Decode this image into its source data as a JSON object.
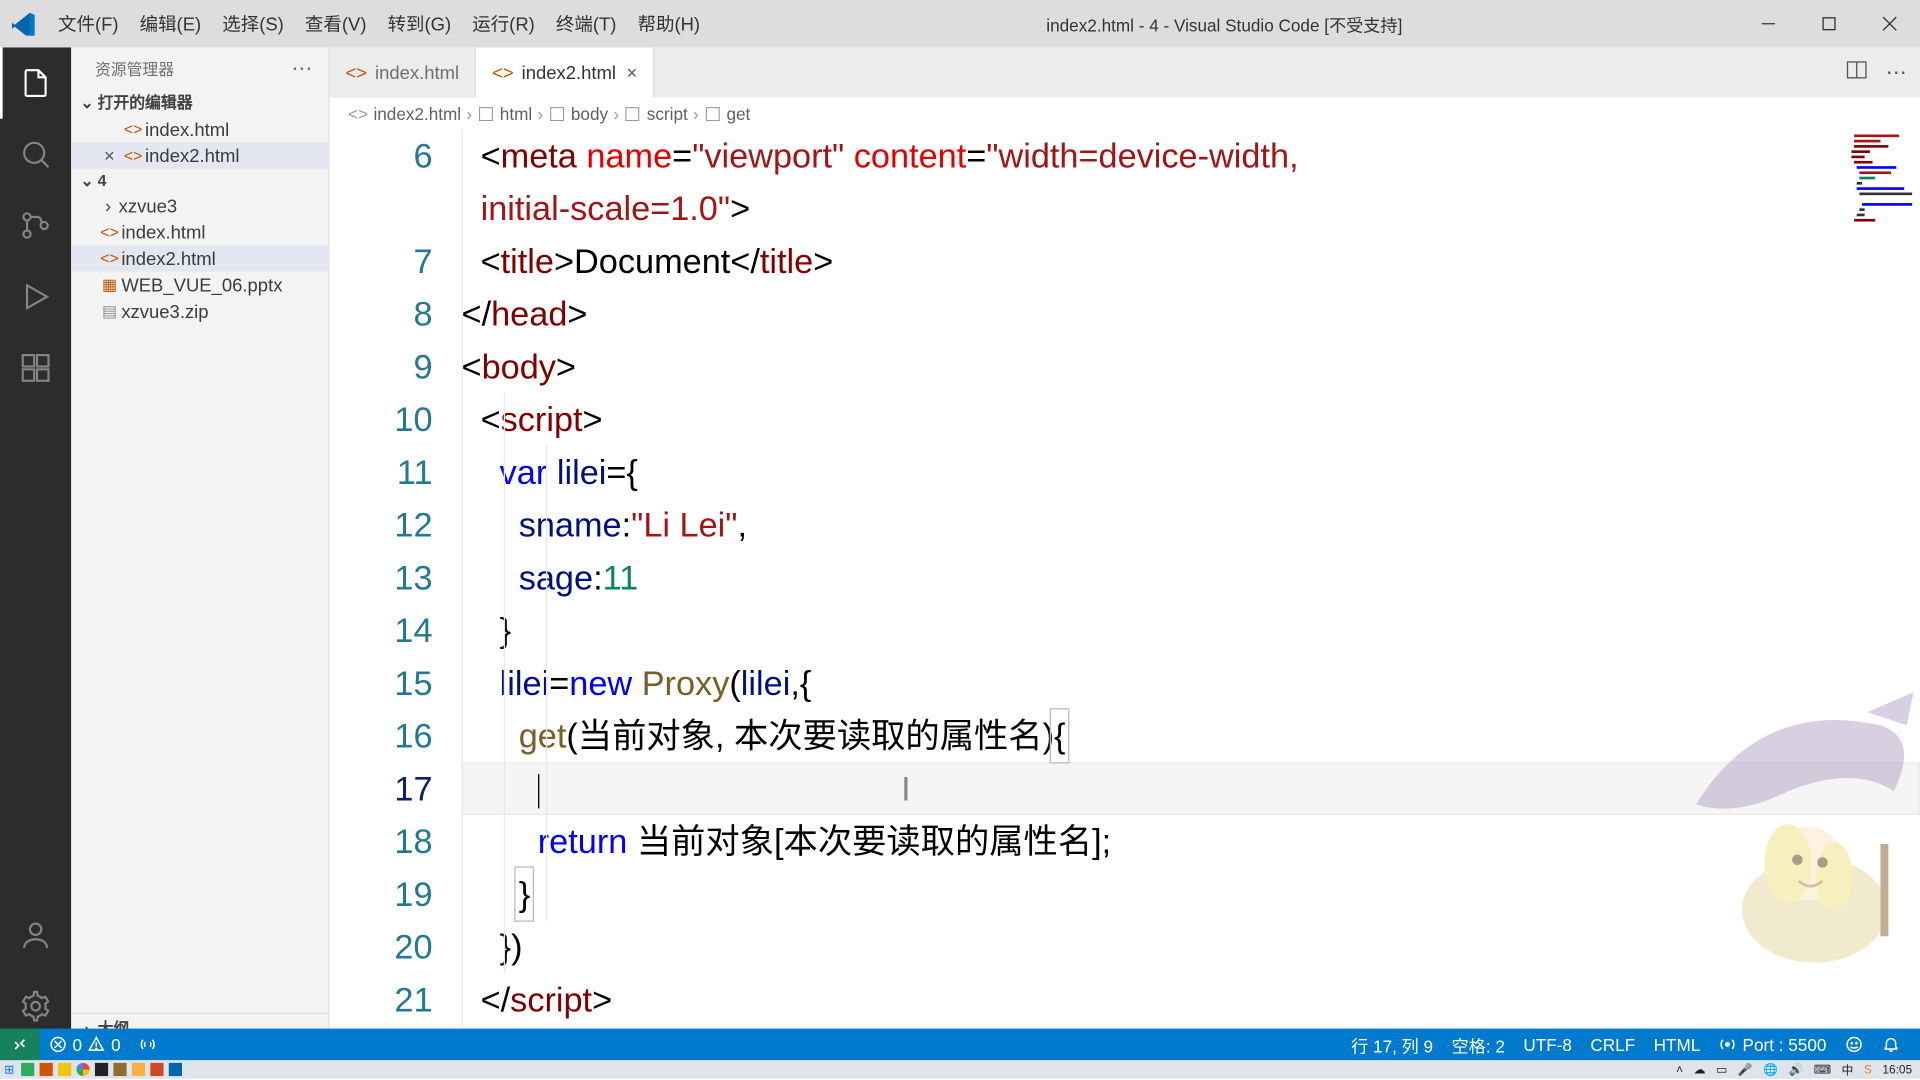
{
  "window": {
    "title": "index2.html - 4 - Visual Studio Code [不受支持]"
  },
  "menu": {
    "file": "文件(F)",
    "edit": "编辑(E)",
    "select": "选择(S)",
    "view": "查看(V)",
    "goto": "转到(G)",
    "run": "运行(R)",
    "terminal": "终端(T)",
    "help": "帮助(H)"
  },
  "sidebar": {
    "title": "资源管理器",
    "open_editors": "打开的编辑器",
    "openItems": [
      {
        "name": "index.html",
        "close": ""
      },
      {
        "name": "index2.html",
        "close": "×"
      }
    ],
    "folderName": "4",
    "tree": [
      {
        "name": "xzvue3",
        "type": "folder"
      },
      {
        "name": "index.html",
        "type": "html"
      },
      {
        "name": "index2.html",
        "type": "html",
        "selected": true
      },
      {
        "name": "WEB_VUE_06.pptx",
        "type": "pptx"
      },
      {
        "name": "xzvue3.zip",
        "type": "zip"
      }
    ],
    "outline": "大纲"
  },
  "tabs": [
    {
      "name": "index.html",
      "active": false
    },
    {
      "name": "index2.html",
      "active": true
    }
  ],
  "breadcrumb": {
    "a": "index2.html",
    "b": "html",
    "c": "body",
    "d": "script",
    "e": "get"
  },
  "code": {
    "start": 6,
    "lines": [
      {
        "n": 6,
        "html": "  <span class='tok-pl'>&lt;</span><span class='tok-tag'>meta</span> <span class='tok-attr'>name</span>=<span class='tok-str'>\"viewport\"</span> <span class='tok-attr'>content</span>=<span class='tok-str'>\"width=device-width, </span>"
      },
      {
        "n": 0,
        "html": "  <span class='tok-str'>initial-scale=1.0\"</span><span class='tok-pl'>&gt;</span>"
      },
      {
        "n": 7,
        "html": "  <span class='tok-pl'>&lt;</span><span class='tok-tag'>title</span><span class='tok-pl'>&gt;</span>Document<span class='tok-pl'>&lt;/</span><span class='tok-tag'>title</span><span class='tok-pl'>&gt;</span>"
      },
      {
        "n": 8,
        "html": "<span class='tok-pl'>&lt;/</span><span class='tok-tag'>head</span><span class='tok-pl'>&gt;</span>"
      },
      {
        "n": 9,
        "html": "<span class='tok-pl'>&lt;</span><span class='tok-tag'>body</span><span class='tok-pl'>&gt;</span>"
      },
      {
        "n": 10,
        "html": "  <span class='tok-pl'>&lt;</span><span class='tok-tag'>script</span><span class='tok-pl'>&gt;</span>"
      },
      {
        "n": 11,
        "html": "    <span class='tok-kw'>var</span> <span class='tok-var'>lilei</span>=<span class='tok-pl'>{</span>"
      },
      {
        "n": 12,
        "html": "      <span class='tok-prop'>sname</span>:<span class='tok-str'>\"Li Lei\"</span>,"
      },
      {
        "n": 13,
        "html": "      <span class='tok-prop'>sage</span>:<span class='tok-num'>11</span>"
      },
      {
        "n": 14,
        "html": "    <span class='tok-pl'>}</span>"
      },
      {
        "n": 15,
        "html": "    <span class='tok-var'>lilei</span>=<span class='tok-kw'>new</span> <span class='tok-fn'>Proxy</span>(<span class='tok-var'>lilei</span>,{"
      },
      {
        "n": 16,
        "html": "      <span class='tok-fn'>get</span>(当前对象, 本次要读取的属性名)<span class='hlbox'>{</span>"
      },
      {
        "n": 17,
        "active": true,
        "html": "        <span class='cursor-caret'></span>                                      <span style='color:#888'>I</span>"
      },
      {
        "n": 18,
        "html": "        <span class='tok-kw'>return</span> 当前对象[本次要读取的属性名];"
      },
      {
        "n": 19,
        "html": "      <span class='hlbox'>}</span>"
      },
      {
        "n": 20,
        "html": "    })"
      },
      {
        "n": 21,
        "html": "  <span class='tok-pl'>&lt;/</span><span class='tok-tag'>script</span><span class='tok-pl'>&gt;</span>"
      }
    ]
  },
  "status": {
    "errors": "0",
    "warnings": "0",
    "linecol": "行 17, 列 9",
    "spaces": "空格: 2",
    "enc": "UTF-8",
    "eol": "CRLF",
    "lang": "HTML",
    "port": "Port : 5500"
  },
  "taskbar": {
    "time": "16:05"
  }
}
